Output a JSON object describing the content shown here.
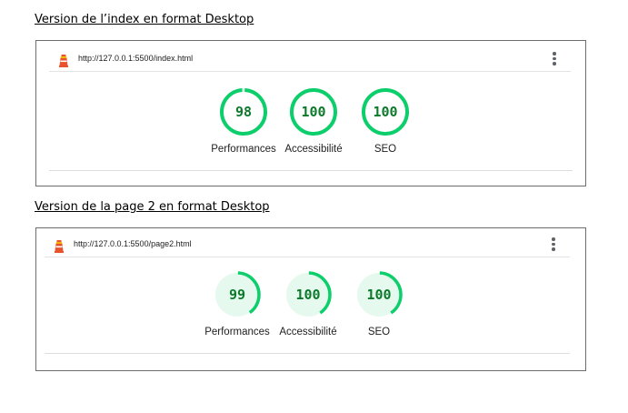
{
  "sections": [
    {
      "caption": "Version de l’index en format Desktop",
      "url": "http://127.0.0.1:5500/index.html",
      "gauges": [
        {
          "label": "Performances",
          "score": "98",
          "value": 98
        },
        {
          "label": "Accessibilité",
          "score": "100",
          "value": 100
        },
        {
          "label": "SEO",
          "score": "100",
          "value": 100
        }
      ]
    },
    {
      "caption": "Version de la page 2 en format Desktop",
      "url": "http://127.0.0.1:5500/page2.html",
      "gauges": [
        {
          "label": "Performances",
          "score": "99",
          "value": 99
        },
        {
          "label": "Accessibilité",
          "score": "100",
          "value": 100
        },
        {
          "label": "SEO",
          "score": "100",
          "value": 100
        }
      ]
    }
  ],
  "colors": {
    "pass_green": "#0cce6b",
    "pass_fill": "#e6f9ee",
    "score_text": "#0c7a2a",
    "lighthouse_orange": "#e8532e"
  },
  "icons": {
    "lighthouse": "lighthouse-icon",
    "menu": "kebab-menu-icon"
  }
}
